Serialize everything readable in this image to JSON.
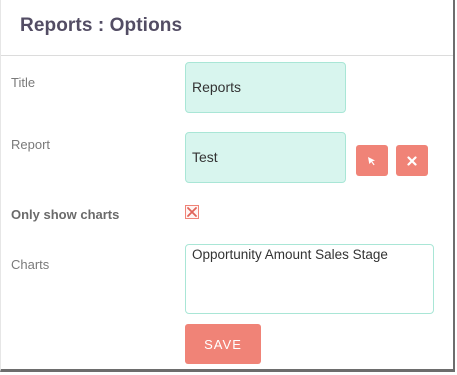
{
  "dialog": {
    "title": "Reports : Options"
  },
  "fields": {
    "title": {
      "label": "Title",
      "value": "Reports"
    },
    "report": {
      "label": "Report",
      "value": "Test"
    },
    "only_show_charts": {
      "label": "Only show charts",
      "checked": true
    },
    "charts": {
      "label": "Charts",
      "value": "Opportunity Amount Sales Stage"
    }
  },
  "buttons": {
    "select_icon": "arrow-pointer-icon",
    "clear_icon": "close-icon",
    "save_label": "SAVE"
  },
  "colors": {
    "accent": "#f08377",
    "field_bg": "#d8f5ee",
    "field_border": "#a9e6d6",
    "title_text": "#534d64"
  }
}
